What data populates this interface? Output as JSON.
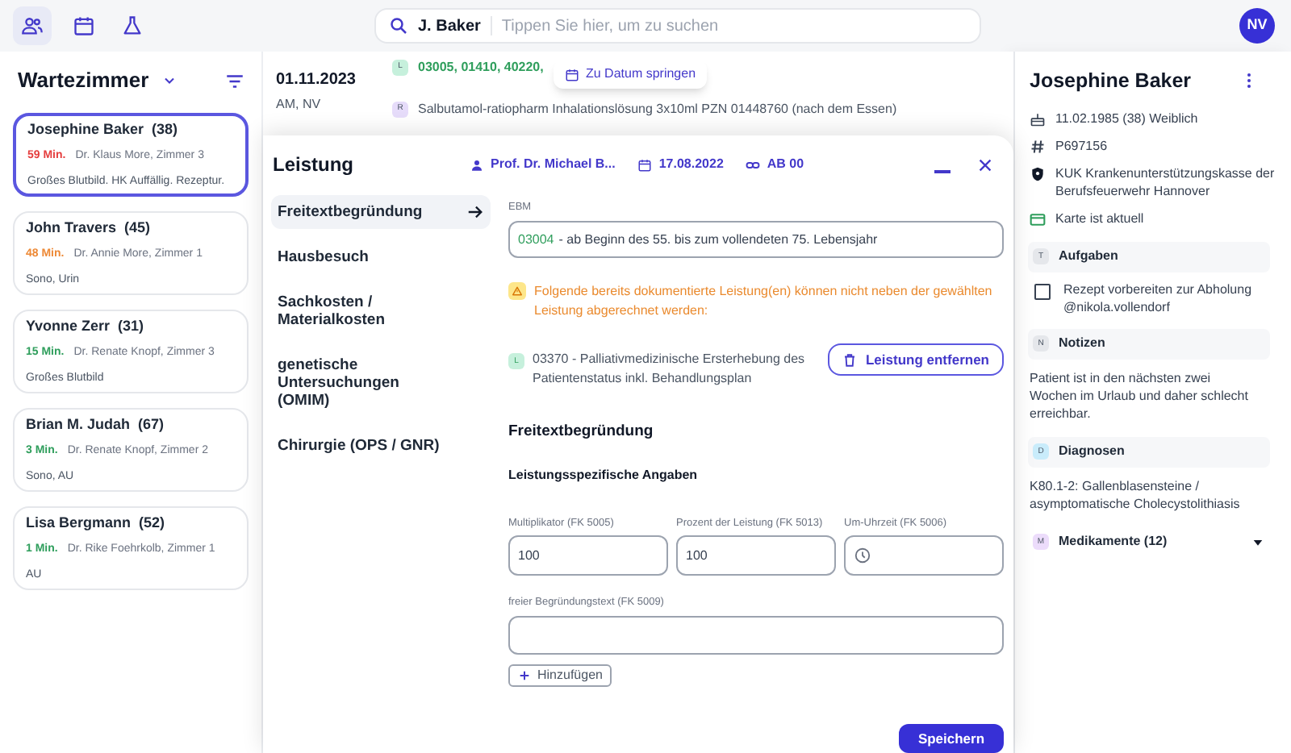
{
  "search": {
    "value": "J. Baker",
    "placeholder": "Tippen Sie hier, um zu suchen"
  },
  "user_avatar": "NV",
  "waiting_room": {
    "title": "Wartezimmer",
    "patients": [
      {
        "name": "Josephine Baker",
        "age": "(38)",
        "wait": "59 Min.",
        "color": "#e53e3e",
        "doctor": "Dr. Klaus More, Zimmer 3",
        "notes": "Großes Blutbild. HK Auffällig. Rezeptur.",
        "selected": true
      },
      {
        "name": "John Travers",
        "age": "(45)",
        "wait": "48 Min.",
        "color": "#ed8936",
        "doctor": "Dr. Annie More, Zimmer 1",
        "notes": "Sono, Urin",
        "selected": false
      },
      {
        "name": "Yvonne Zerr",
        "age": "(31)",
        "wait": "15 Min.",
        "color": "#2f9e5c",
        "doctor": "Dr. Renate Knopf, Zimmer 3",
        "notes": "Großes Blutbild",
        "selected": false
      },
      {
        "name": "Brian M. Judah",
        "age": "(67)",
        "wait": "3 Min.",
        "color": "#2f9e5c",
        "doctor": "Dr. Renate Knopf, Zimmer 2",
        "notes": "Sono, AU",
        "selected": false
      },
      {
        "name": "Lisa Bergmann",
        "age": "(52)",
        "wait": "1 Min.",
        "color": "#2f9e5c",
        "doctor": "Dr. Rike Foehrkolb, Zimmer 1",
        "notes": "AU",
        "selected": false
      }
    ]
  },
  "timeline": {
    "date": "01.11.2023",
    "subtitle": "AM, NV",
    "entries": [
      {
        "badge": "L",
        "color": "#c6f0dc",
        "kind": "codes",
        "text": "03005, 01410, 40220,"
      },
      {
        "badge": "R",
        "color": "#e6dcfa",
        "kind": "text",
        "text": "Salbutamol-ratiopharm Inhalationslösung 3x10ml PZN 01448760 (nach dem Essen)"
      }
    ]
  },
  "jump_button": "Zu Datum springen",
  "modal": {
    "title": "Leistung",
    "doctor": "Prof. Dr. Michael B...",
    "date": "17.08.2022",
    "code": "AB 00",
    "categories": [
      {
        "label": "Freitextbegründung",
        "selected": true
      },
      {
        "label": "Hausbesuch",
        "selected": false
      },
      {
        "label": "Sachkosten / Materialkosten",
        "selected": false
      },
      {
        "label": "genetische Untersuchungen (OMIM)",
        "selected": false
      },
      {
        "label": "Chirurgie (OPS / GNR)",
        "selected": false
      }
    ],
    "ebm_label": "EBM",
    "ebm_code": "03004",
    "ebm_text": "- ab Beginn des 55. bis zum vollendeten 75. Lebensjahr",
    "warning": "Folgende bereits dokumentierte Leistung(en) können nicht neben der gewählten Leistung abgerechnet werden:",
    "conflict": {
      "badge": "L",
      "text": "03370 - Palliativmedizinische Ersterhebung des Patientenstatus inkl. Behandlungsplan"
    },
    "remove_button": "Leistung entfernen",
    "section_title": "Freitextbegründung",
    "subsection_title": "Leistungsspezifische Angaben",
    "fields": [
      {
        "label": "Multiplikator (FK 5005)",
        "value": "100",
        "kind": "text"
      },
      {
        "label": "Prozent der Leistung (FK 5013)",
        "value": "100",
        "kind": "text"
      },
      {
        "label": "Um-Uhrzeit (FK 5006)",
        "kind": "time"
      }
    ],
    "reason_label": "freier Begründungstext (FK 5009)",
    "add_button": "Hinzufügen",
    "save_button": "Speichern"
  },
  "patient": {
    "name": "Josephine Baker",
    "details": [
      {
        "kind": "birth",
        "text": "11.02.1985 (38) Weiblich"
      },
      {
        "kind": "id",
        "text": "P697156"
      },
      {
        "kind": "insurance",
        "text": "KUK Krankenunterstützungskasse der Berufsfeuerwehr Hannover"
      },
      {
        "kind": "card",
        "text": "Karte ist aktuell"
      }
    ],
    "sections": [
      {
        "badge": "T",
        "color": "#e5e7eb",
        "title": "Aufgaben",
        "kind": "tasks",
        "tasks": [
          {
            "text": "Rezept vorbereiten zur Abholung @nikola.vollendorf",
            "checked": false
          }
        ]
      },
      {
        "badge": "N",
        "color": "#e5e7eb",
        "title": "Notizen",
        "kind": "text",
        "text": "Patient ist in den nächsten zwei Wochen im Urlaub und daher schlecht erreichbar."
      },
      {
        "badge": "D",
        "color": "#c9ecfb",
        "title": "Diagnosen",
        "kind": "text",
        "text": "K80.1-2: Gallenblasensteine / asymptomatische Cholecystolithiasis"
      },
      {
        "badge": "M",
        "color": "#ecdcfb",
        "title": "Medikamente (12)",
        "kind": "collapsible",
        "expanded": false
      }
    ]
  }
}
